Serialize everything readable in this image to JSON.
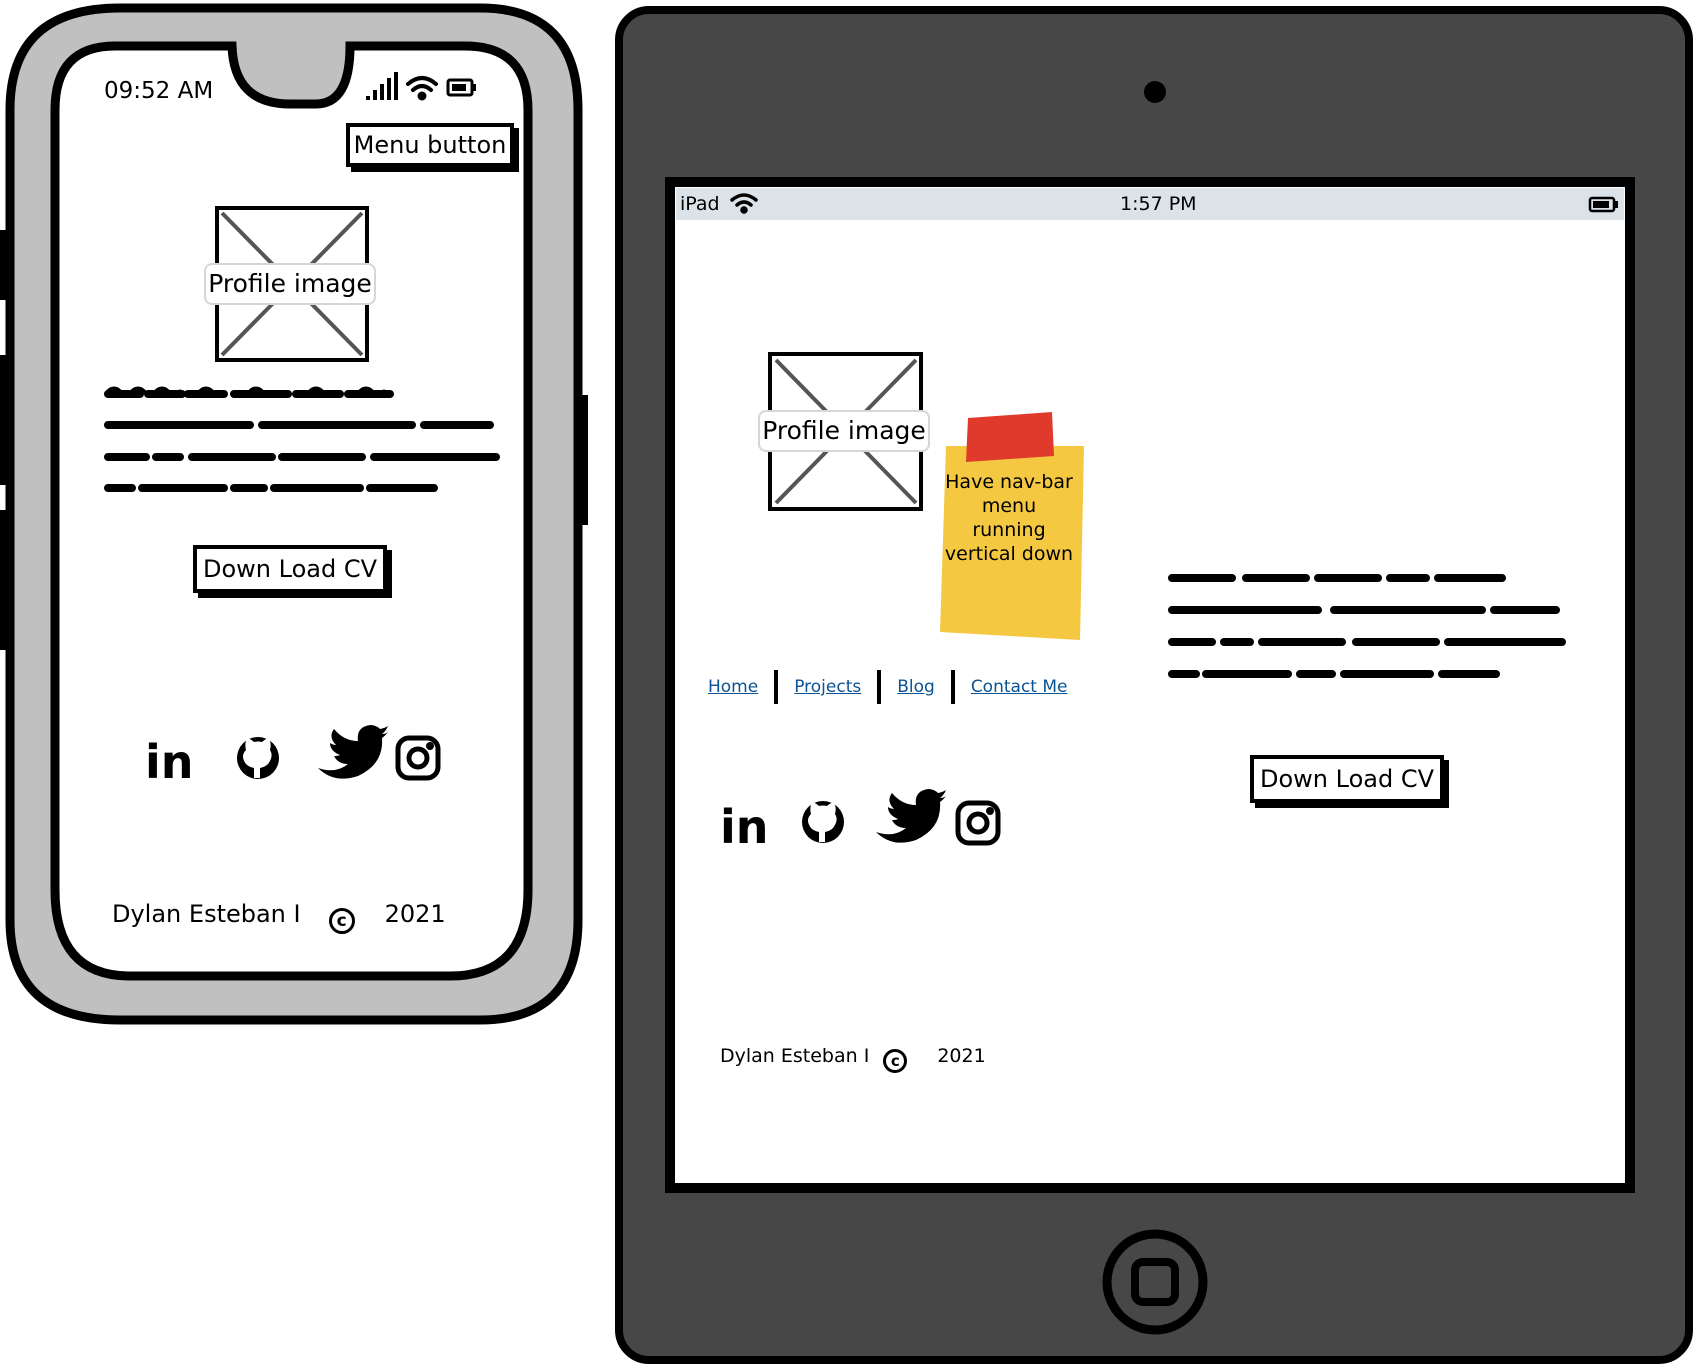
{
  "phone": {
    "status_time": "09:52 AM",
    "menu_button": "Menu button",
    "profile_image_label": "Profile image",
    "download_cv": "Down Load CV",
    "social_icons": [
      "linkedin-icon",
      "github-icon",
      "twitter-icon",
      "instagram-icon"
    ],
    "footer": {
      "name": "Dylan Esteban I",
      "year": "2021"
    }
  },
  "tablet": {
    "status": {
      "carrier": "iPad",
      "time": "1:57 PM"
    },
    "profile_image_label": "Profile image",
    "sticky_note": "Have nav-bar menu running vertical down",
    "nav": [
      "Home",
      "Projects",
      "Blog",
      "Contact Me"
    ],
    "download_cv": "Down Load CV",
    "social_icons": [
      "linkedin-icon",
      "github-icon",
      "twitter-icon",
      "instagram-icon"
    ],
    "footer": {
      "name": "Dylan Esteban I",
      "year": "2021"
    }
  },
  "colors": {
    "phone_frame": "#c0c0c0",
    "tablet_frame": "#474747",
    "status_bar": "#dce3e8",
    "sticky_note": "#f5c842",
    "sticky_tape": "#e03a2c",
    "link": "#0b5394"
  }
}
